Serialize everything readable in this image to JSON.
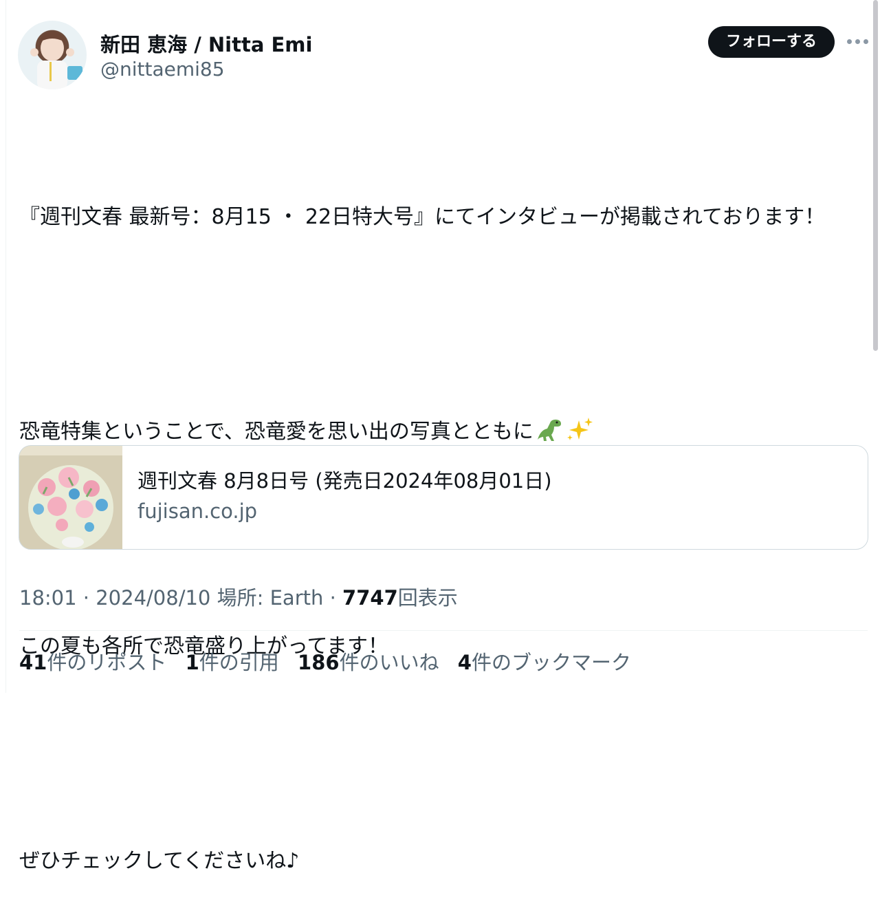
{
  "user": {
    "display_name": "新田 恵海 / Nitta Emi",
    "handle": "@nittaemi85",
    "follow_label": "フォローする"
  },
  "tweet": {
    "line1": "『週刊文春 最新号：8月15 ・ 22日特大号』にてインタビューが掲載されております！",
    "line2": "恐竜特集ということで、恐竜愛を思い出の写真とともに",
    "line3": "この夏も各所で恐竜盛り上がってます！",
    "line4": "ぜひチェックしてくださいね♪"
  },
  "emojis": [
    "t-rex-emoji",
    "sparkles-emoji"
  ],
  "link_card": {
    "title": "週刊文春 8月8日号 (発売日2024年08月01日)",
    "domain": "fujisan.co.jp"
  },
  "meta": {
    "time": "18:01",
    "date": "2024/08/10",
    "location_label": "場所: Earth",
    "views_count": "7747",
    "views_label": "回表示"
  },
  "stats": {
    "reposts_count": "41",
    "reposts_label": "件のリポスト",
    "quotes_count": "1",
    "quotes_label": "件の引用",
    "likes_count": "186",
    "likes_label": "件のいいね",
    "bookmarks_count": "4",
    "bookmarks_label": "件のブックマーク"
  }
}
